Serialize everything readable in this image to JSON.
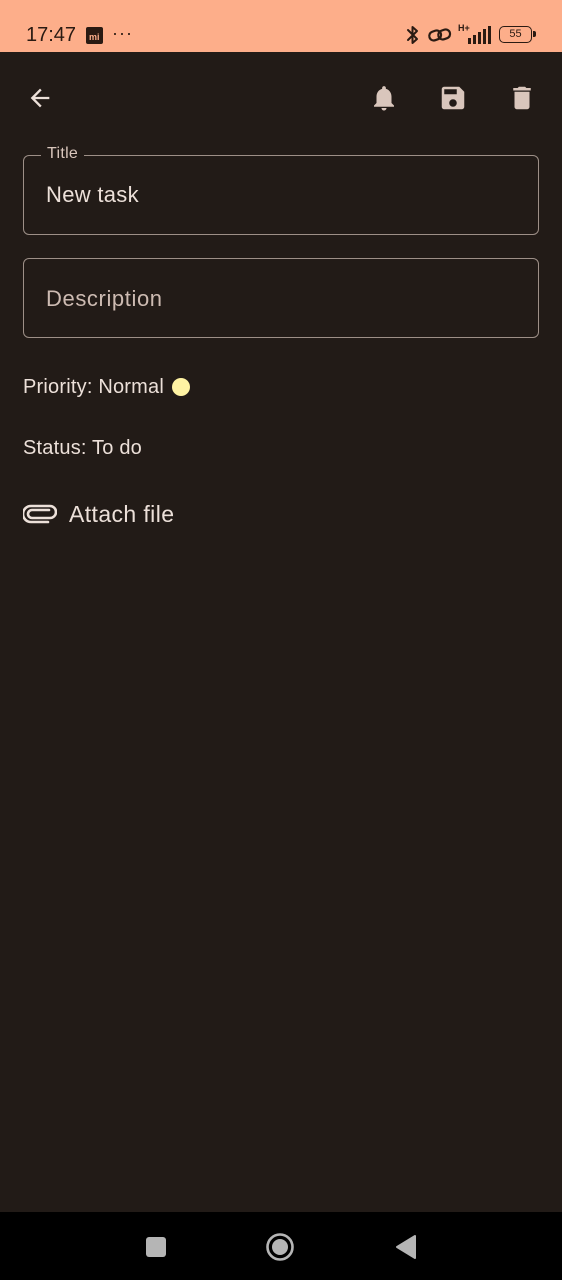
{
  "status_bar": {
    "time": "17:47",
    "more": "···",
    "network": "H+",
    "battery": "55"
  },
  "toolbar": {
    "back_icon": "arrow-back-icon",
    "icons": [
      "bell-icon",
      "save-icon",
      "delete-icon"
    ]
  },
  "form": {
    "title_label": "Title",
    "title_value": "New task",
    "description_placeholder": "Description",
    "priority_text": "Priority: Normal",
    "priority_color": "#fff3a3",
    "status_text": "Status: To do",
    "attach_label": "Attach file"
  },
  "colors": {
    "background": "#221b17",
    "status_bar": "#fdae8a",
    "text": "#ece0d9"
  }
}
